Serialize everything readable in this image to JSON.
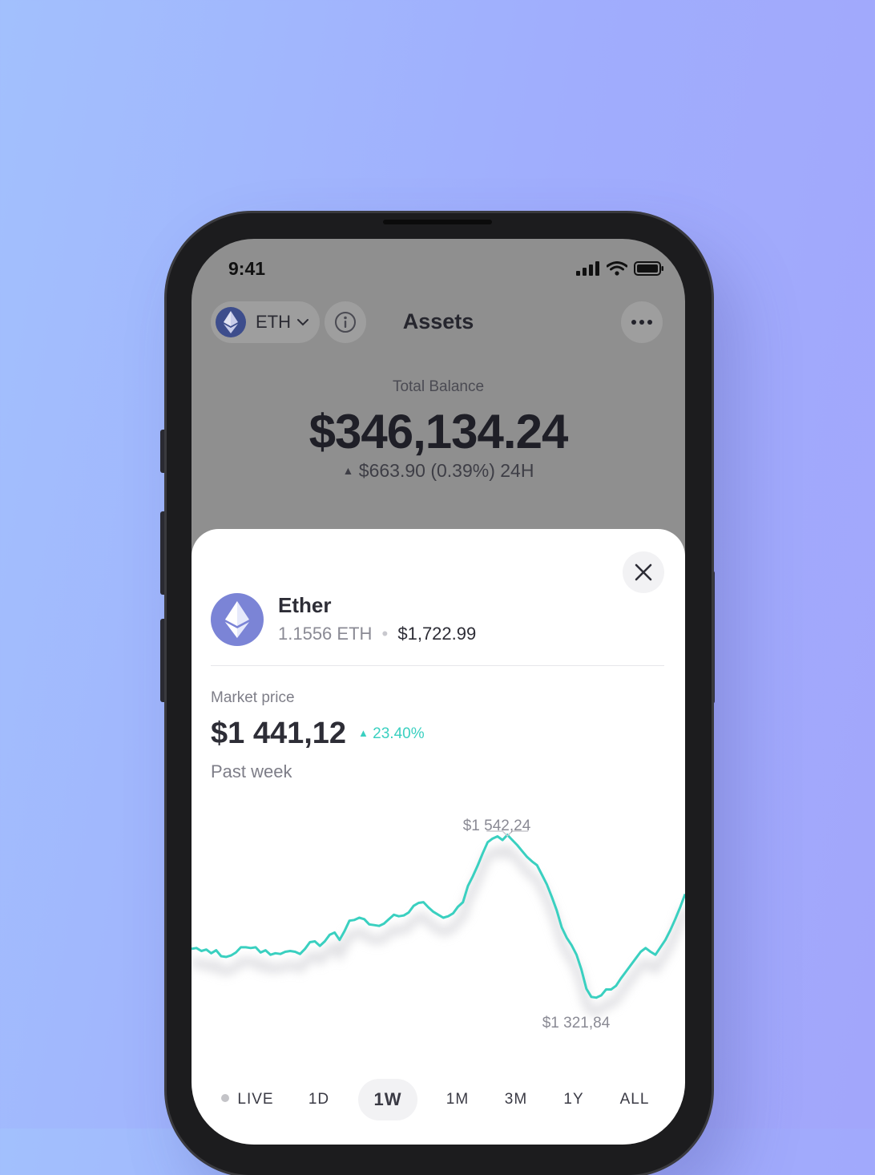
{
  "status": {
    "time": "9:41"
  },
  "header": {
    "asset_pill": {
      "label": "ETH"
    },
    "title": "Assets"
  },
  "balance": {
    "label": "Total Balance",
    "value": "$346,134.24",
    "change": "$663.90 (0.39%) 24H"
  },
  "sheet": {
    "coin": {
      "name": "Ether",
      "amount": "1.1556 ETH",
      "fiat": "$1,722.99"
    },
    "market": {
      "label": "Market price",
      "value": "$1 441,12",
      "change": "23.40%",
      "period": "Past week"
    },
    "chart_data": {
      "type": "line",
      "title": "",
      "high_label": "$1 542,24",
      "low_label": "$1 321,84",
      "series": [
        {
          "values": [
            1388,
            1389,
            1385,
            1387,
            1382,
            1386,
            1378,
            1377,
            1379,
            1383,
            1390,
            1390,
            1389,
            1390,
            1383,
            1386,
            1380,
            1382,
            1381,
            1384,
            1385,
            1384,
            1381,
            1388,
            1397,
            1398,
            1392,
            1398,
            1407,
            1410,
            1400,
            1412,
            1426,
            1427,
            1430,
            1428,
            1421,
            1420,
            1419,
            1422,
            1428,
            1434,
            1432,
            1433,
            1437,
            1446,
            1450,
            1451,
            1444,
            1438,
            1434,
            1430,
            1432,
            1436,
            1445,
            1451,
            1473,
            1486,
            1501,
            1517,
            1532,
            1537,
            1540,
            1535,
            1542,
            1535,
            1528,
            1520,
            1512,
            1506,
            1501,
            1488,
            1475,
            1458,
            1440,
            1417,
            1403,
            1393,
            1380,
            1360,
            1334,
            1323,
            1322,
            1325,
            1333,
            1333,
            1338,
            1348,
            1357,
            1366,
            1375,
            1384,
            1389,
            1384,
            1380,
            1390,
            1400,
            1413,
            1428,
            1444,
            1462
          ]
        }
      ],
      "color": "#3ad0c0",
      "ylim": [
        1300,
        1560
      ]
    },
    "tabs": [
      "LIVE",
      "1D",
      "1W",
      "1M",
      "3M",
      "1Y",
      "ALL"
    ],
    "active_tab": "1W"
  }
}
